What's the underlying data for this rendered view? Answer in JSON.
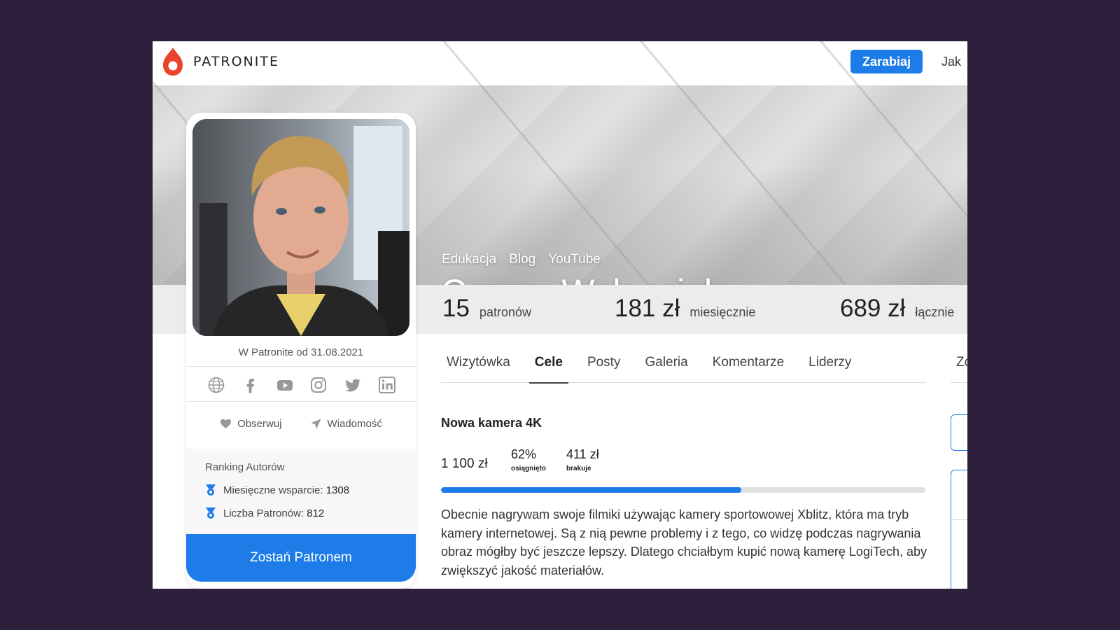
{
  "header": {
    "logo_text": "PATRONITE",
    "earn_button": "Zarabiaj",
    "nav_cut": "Jak"
  },
  "cover": {
    "tags": [
      "Edukacja",
      "Blog",
      "YouTube"
    ],
    "name": "Cezary Walenciuk"
  },
  "stats": {
    "patrons_value": "15",
    "patrons_label": "patronów",
    "monthly_value": "181 zł",
    "monthly_label": "miesięcznie",
    "total_value": "689 zł",
    "total_label": "łącznie"
  },
  "card": {
    "since": "W Patronite od 31.08.2021",
    "socials": [
      "globe-icon",
      "facebook-icon",
      "youtube-icon",
      "instagram-icon",
      "twitter-icon",
      "linkedin-icon"
    ],
    "follow_label": "Obserwuj",
    "message_label": "Wiadomość",
    "ranking_title": "Ranking Autorów",
    "ranking_monthly_label": "Miesięczne wsparcie:",
    "ranking_monthly_value": "1308",
    "ranking_patrons_label": "Liczba Patronów:",
    "ranking_patrons_value": "812",
    "become_patron": "Zostań Patronem"
  },
  "tabs": {
    "items": [
      "Wizytówka",
      "Cele",
      "Posty",
      "Galeria",
      "Komentarze",
      "Liderzy"
    ],
    "active": "Cele",
    "cut": "Zo"
  },
  "goal": {
    "title": "Nowa kamera 4K",
    "amount": "1 100 zł",
    "percent": "62%",
    "percent_label": "osiągnięto",
    "missing": "411 zł",
    "missing_label": "brakuje",
    "progress_fraction": 0.62,
    "description": "Obecnie nagrywam swoje filmiki używając kamery sportowowej Xblitz, która ma tryb kamery internetowej. Są z nią pewne problemy i z tego, co widzę podczas nagrywania obraz mógłby być jeszcze lepszy. Dlatego chciałbym kupić nową kamerę LogiTech, aby zwiększyć jakość materiałów."
  },
  "colors": {
    "accent": "#1e7ce8",
    "logo_red": "#e8442e",
    "background": "#2e1f3c"
  }
}
